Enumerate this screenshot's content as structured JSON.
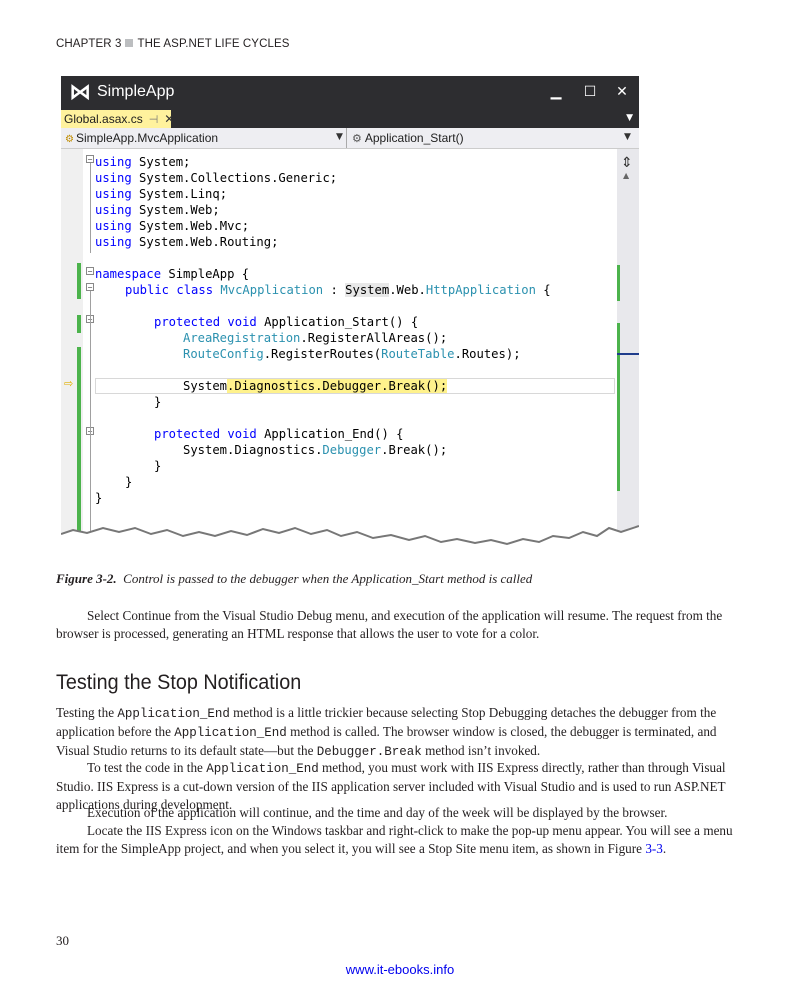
{
  "header": {
    "chapter": "CHAPTER 3",
    "title": "THE ASP.NET LIFE CYCLES"
  },
  "ide": {
    "app_title": "SimpleApp",
    "minimize": "▁",
    "maximize": "☐",
    "close": "✕",
    "tab_label": "Global.asax.cs",
    "tab_pin": "⊣",
    "tab_close": "✕",
    "nav_left": "SimpleApp.MvcApplication",
    "nav_right": "Application_Start()",
    "code": {
      "l1_kw": "using",
      "l1": " System;",
      "l2_kw": "using",
      "l2": " System.Collections.Generic;",
      "l3_kw": "using",
      "l3": " System.Linq;",
      "l4_kw": "using",
      "l4": " System.Web;",
      "l5_kw": "using",
      "l5": " System.Web.Mvc;",
      "l6_kw": "using",
      "l6": " System.Web.Routing;",
      "l7_kw": "namespace",
      "l7": " SimpleApp {",
      "l8_kw1": "public",
      "l8_kw2": "class",
      "l8_ty": "MvcApplication",
      "l8_mid": " : ",
      "l8_hl": "System",
      "l8_mid2": ".Web.",
      "l8_ty2": "HttpApplication",
      "l8_end": " {",
      "l9_kw1": "protected",
      "l9_kw2": "void",
      "l9": " Application_Start() {",
      "l10_ty": "AreaRegistration",
      "l10": ".RegisterAllAreas();",
      "l11_ty": "RouteConfig",
      "l11": ".RegisterRoutes(",
      "l11_ty2": "RouteTable",
      "l11_end": ".Routes);",
      "l12_a": "System",
      "l12_b": ".Diagnostics.Debugger.Break();",
      "l13": "}",
      "l14_kw1": "protected",
      "l14_kw2": "void",
      "l14": " Application_End() {",
      "l15_a": "System.Diagnostics.",
      "l15_ty": "Debugger",
      "l15_b": ".Break();",
      "l16": "}",
      "l17": "}",
      "l18": "}"
    }
  },
  "caption": {
    "label": "Figure 3-2.",
    "text": "Control is passed to the debugger when the Application_Start method is called"
  },
  "para1": {
    "text": "Select Continue from the Visual Studio Debug menu, and execution of the application will resume. The request from the browser is processed, generating an HTML response that allows the user to vote for a color."
  },
  "section": {
    "title": "Testing the Stop Notification"
  },
  "para2": {
    "a": "Testing the ",
    "b": "Application_End",
    "c": " method is a little trickier because selecting Stop Debugging detaches the debugger from the application before the ",
    "d": "Application_End",
    "e": " method is called. The browser window is closed, the debugger is terminated, and Visual Studio returns to its default state—but the ",
    "f": "Debugger.Break",
    "g": " method isn’t invoked."
  },
  "para3": {
    "a": "To test the code in the ",
    "b": "Application_End",
    "c": " method, you must work with IIS Express directly, rather than through Visual Studio. IIS Express is a cut-down version of the IIS application server included with Visual Studio and is used to run ASP.NET applications during development."
  },
  "para4": {
    "text": "Execution of the application will continue, and the time and day of the week will be displayed by the browser."
  },
  "para5": {
    "a": "Locate the IIS Express icon on the Windows taskbar and right-click to make the pop-up menu appear. You will see a menu item for the SimpleApp project, and when you select it, you will see a Stop Site menu item, as shown in Figure ",
    "link": "3-3",
    "b": "."
  },
  "footer": {
    "page_number": "30",
    "url": "www.it-ebooks.info"
  }
}
